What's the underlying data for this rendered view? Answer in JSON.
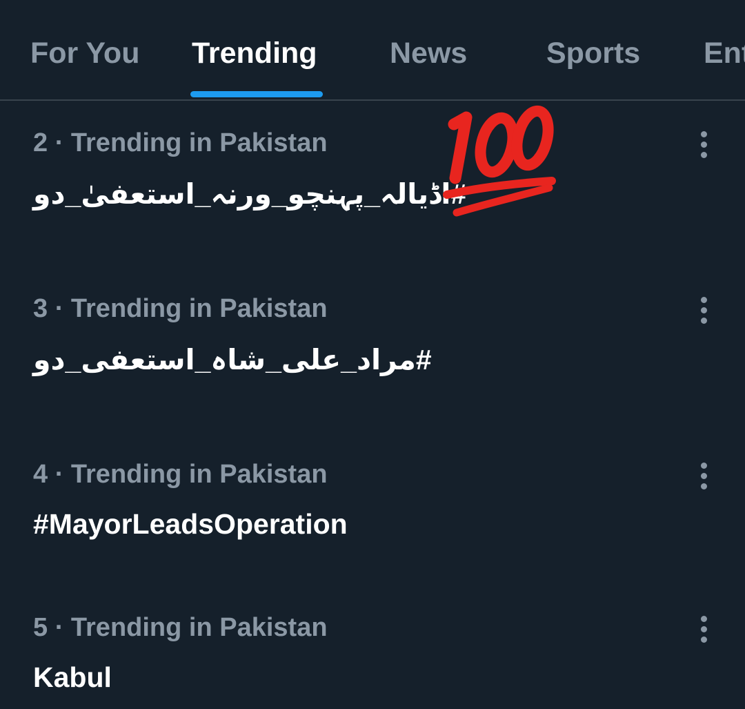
{
  "tabs": [
    {
      "label": "For You",
      "active": false
    },
    {
      "label": "Trending",
      "active": true
    },
    {
      "label": "News",
      "active": false
    },
    {
      "label": "Sports",
      "active": false
    },
    {
      "label": "Ent",
      "active": false
    }
  ],
  "trends": [
    {
      "meta": "2 · Trending in Pakistan",
      "name": "#اڈیالہ_پہنچو_ورنہ_استعفیٰ_دو"
    },
    {
      "meta": "3 · Trending in Pakistan",
      "name": "#مراد_علی_شاہ_استعفی_دو"
    },
    {
      "meta": "4 · Trending in Pakistan",
      "name": "#MayorLeadsOperation"
    },
    {
      "meta": "5 · Trending in Pakistan",
      "name": "Kabul"
    }
  ],
  "decorations": {
    "emoji_icon": "hundred-points-icon"
  },
  "colors": {
    "background": "#15202b",
    "accent": "#1d9bf0",
    "muted_text": "#8b98a5",
    "primary_text": "#ffffff",
    "divider": "#38444d",
    "emoji_red": "#e8251f"
  }
}
